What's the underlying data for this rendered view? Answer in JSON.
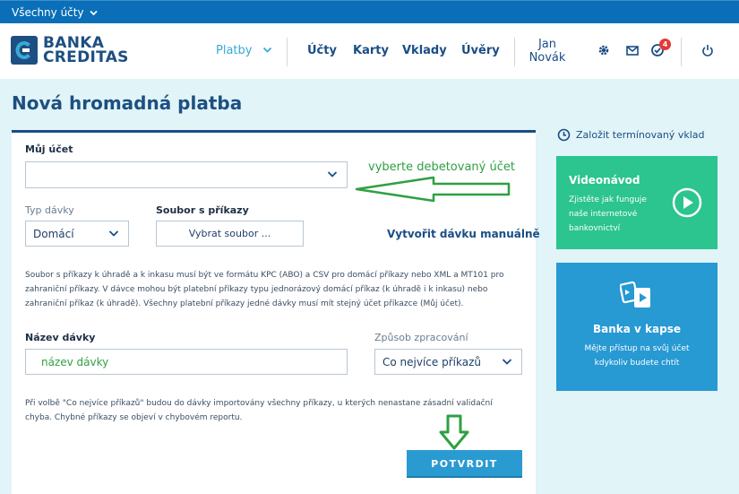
{
  "topbar": {
    "account_switch": "Všechny účty"
  },
  "header": {
    "logo_line1": "BANKA",
    "logo_line2": "CREDITAS",
    "nav": {
      "platby": "Platby",
      "ucty": "Účty",
      "karty": "Karty",
      "vklady": "Vklady",
      "uvery": "Úvěry"
    },
    "user_first": "Jan",
    "user_last": "Novák",
    "notification_count": "4"
  },
  "page_title": "Nová hromadná platba",
  "form": {
    "account_label": "Můj účet",
    "account_value": "",
    "account_hint": "vyberte debetovaný účet",
    "batch_type_label": "Typ dávky",
    "batch_type_value": "Domácí",
    "file_label": "Soubor s příkazy",
    "file_button": "Vybrat soubor ...",
    "manual_link": "Vytvořit dávku manuálně",
    "info_text_1": "Soubor s příkazy k úhradě a k inkasu musí být ve formátu KPC (ABO) a CSV pro domácí příkazy nebo XML a MT101 pro",
    "info_text_2": "zahraniční příkazy. V dávce mohou být platební příkazy typu jednorázový domácí příkaz (k úhradě i k inkasu) nebo",
    "info_text_3": "zahraniční příkaz (k úhradě). Všechny platební příkazy jedné dávky musí mít stejný účet příkazce (Můj účet).",
    "batch_name_label": "Název dávky",
    "batch_name_value": "název dávky",
    "processing_label": "Způsob zpracování",
    "processing_value": "Co nejvíce příkazů",
    "note_1": "Při volbě \"Co nejvíce příkazů\" budou do dávky importovány všechny příkazy, u kterých nenastane zásadní validační",
    "note_2": "chyba. Chybné příkazy se objeví v chybovém reportu.",
    "confirm_button": "POTVRDIT"
  },
  "sidebar": {
    "term_deposit_link": "Založit termínovaný vklad",
    "video_card": {
      "title": "Videonávod",
      "text_1": "Zjistěte jak funguje",
      "text_2": "naše internetové",
      "text_3": "bankovnictví"
    },
    "app_card": {
      "title": "Banka v kapse",
      "text_1": "Mějte přístup na svůj účet",
      "text_2": "kdykoliv budete chtít"
    }
  },
  "colors": {
    "primary": "#1a4d86",
    "accent": "#2a9bd1",
    "green_card": "#2cc48f",
    "annotation": "#2ea043"
  }
}
